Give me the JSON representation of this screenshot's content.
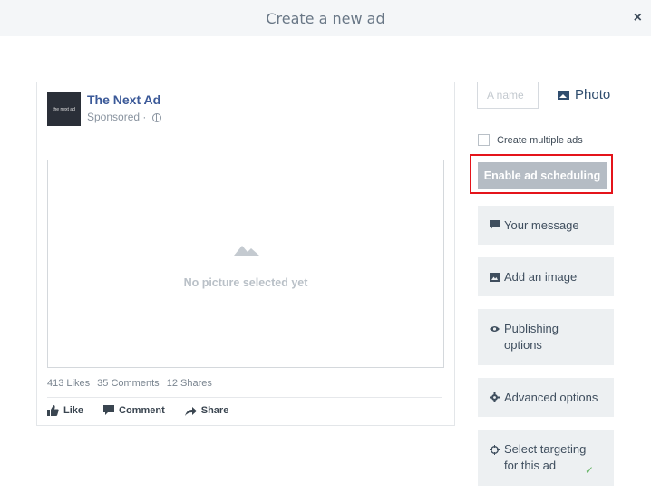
{
  "header": {
    "title": "Create a new ad",
    "close_label": "×"
  },
  "preview": {
    "avatar_text": "the next ad",
    "page_name": "The Next Ad",
    "sponsored": "Sponsored ·",
    "no_picture_text": "No picture selected yet",
    "stats": {
      "likes": "413 Likes",
      "comments": "35 Comments",
      "shares": "12 Shares"
    },
    "actions": {
      "like": "Like",
      "comment": "Comment",
      "share": "Share"
    }
  },
  "sidebar": {
    "name_placeholder": "A name",
    "photo_label": "Photo",
    "create_multiple_label": "Create multiple ads",
    "create_multiple_checked": false,
    "schedule_button": "Enable ad scheduling",
    "options": {
      "message": "Your message",
      "image": "Add an image",
      "publishing": "Publishing options",
      "advanced": "Advanced options",
      "targeting": "Select targeting for this ad"
    },
    "targeting_checkmark": "✓"
  },
  "colors": {
    "brand_blue": "#3b5998",
    "highlight_red": "#e4141b",
    "check_green": "#66b466"
  }
}
